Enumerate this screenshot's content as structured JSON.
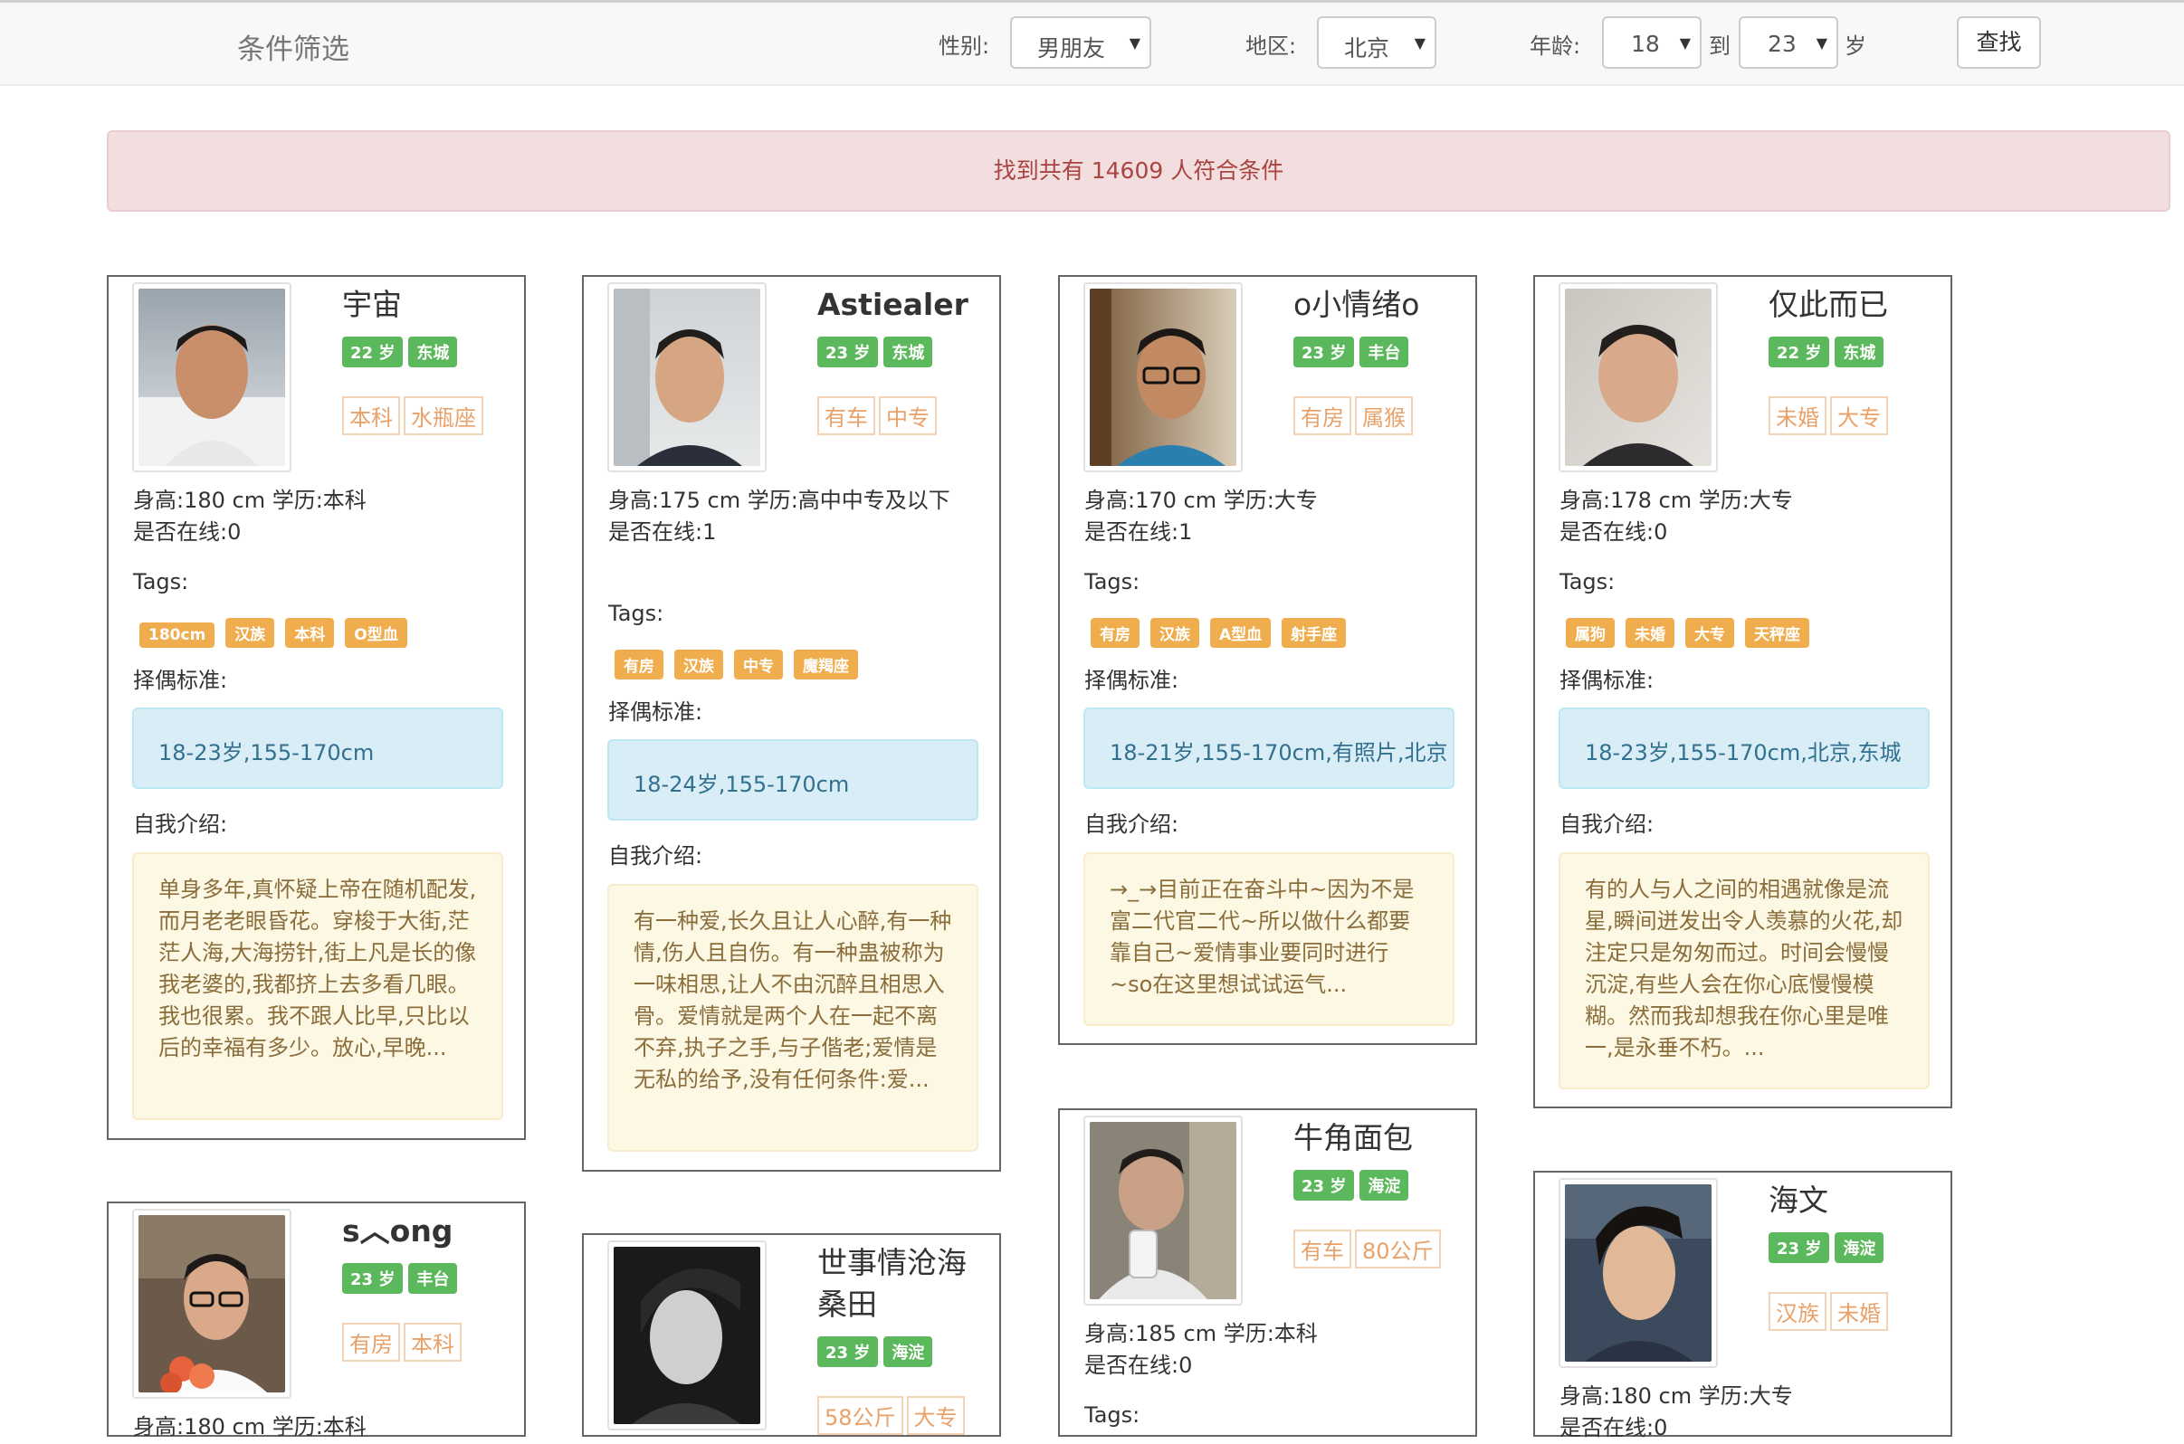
{
  "filter": {
    "title": "条件筛选",
    "gender_label": "性别:",
    "gender_value": "男朋友",
    "region_label": "地区:",
    "region_value": "北京",
    "age_label": "年龄:",
    "age_from": "18",
    "age_to_word": "到",
    "age_to": "23",
    "age_unit": "岁",
    "search_button": "查找"
  },
  "result": {
    "text": "找到共有 14609 人符合条件"
  },
  "labels": {
    "tags": "Tags:",
    "criteria": "择偶标准:",
    "intro": "自我介绍:"
  },
  "cards": [
    {
      "name": "宇宙",
      "age_badge": "22 岁",
      "district_badge": "东城",
      "traits": [
        "本科",
        "水瓶座"
      ],
      "height_line": "身高:180 cm   学历:本科",
      "online_line": "是否在线:0",
      "tags": [
        "180cm",
        "汉族",
        "本科",
        "O型血"
      ],
      "criteria": "18-23岁,155-170cm",
      "intro": "单身多年,真怀疑上帝在随机配发,而月老老眼昏花。穿梭于大街,茫茫人海,大海捞针,街上凡是长的像我老婆的,我都挤上去多看几眼。我也很累。我不跟人比早,只比以后的幸福有多少。放心,早晚..."
    },
    {
      "name": "Astiealer",
      "age_badge": "23 岁",
      "district_badge": "东城",
      "traits": [
        "有车",
        "中专"
      ],
      "height_line": "身高:175 cm   学历:高中中专及以下",
      "online_line": "是否在线:1",
      "tags": [
        "有房",
        "汉族",
        "中专",
        "魔羯座"
      ],
      "criteria": "18-24岁,155-170cm",
      "intro": "有一种爱,长久且让人心醉,有一种情,伤人且自伤。有一种蛊被称为一味相思,让人不由沉醉且相思入骨。爱情就是两个人在一起不离不弃,执子之手,与子偕老;爱情是无私的给予,没有任何条件:爱..."
    },
    {
      "name": "o小情绪o",
      "age_badge": "23 岁",
      "district_badge": "丰台",
      "traits": [
        "有房",
        "属猴"
      ],
      "height_line": "身高:170 cm   学历:大专",
      "online_line": "是否在线:1",
      "tags": [
        "有房",
        "汉族",
        "A型血",
        "射手座"
      ],
      "criteria": "18-21岁,155-170cm,有照片,北京",
      "intro": "→_→目前正在奋斗中~因为不是富二代官二代~所以做什么都要靠自己~爱情事业要同时进行~so在这里想试试运气..."
    },
    {
      "name": "仅此而已",
      "age_badge": "22 岁",
      "district_badge": "东城",
      "traits": [
        "未婚",
        "大专"
      ],
      "height_line": "身高:178 cm   学历:大专",
      "online_line": "是否在线:0",
      "tags": [
        "属狗",
        "未婚",
        "大专",
        "天秤座"
      ],
      "criteria": "18-23岁,155-170cm,北京,东城",
      "intro": "有的人与人之间的相遇就像是流星,瞬间迸发出令人羡慕的火花,却注定只是匆匆而过。时间会慢慢沉淀,有些人会在你心底慢慢模糊。然而我却想我在你心里是唯一,是永垂不朽。..."
    },
    {
      "name": "s︿ong",
      "age_badge": "23 岁",
      "district_badge": "丰台",
      "traits": [
        "有房",
        "本科"
      ],
      "height_line": "身高:180 cm   学历:本科"
    },
    {
      "name": "世事情沧海桑田",
      "age_badge": "23 岁",
      "district_badge": "海淀",
      "traits": [
        "58公斤",
        "大专"
      ]
    },
    {
      "name": "牛角面包",
      "age_badge": "23 岁",
      "district_badge": "海淀",
      "traits": [
        "有车",
        "80公斤"
      ],
      "height_line": "身高:185 cm   学历:本科",
      "online_line": "是否在线:0"
    },
    {
      "name": "海文",
      "age_badge": "23 岁",
      "district_badge": "海淀",
      "traits": [
        "汉族",
        "未婚"
      ],
      "height_line": "身高:180 cm   学历:大专",
      "online_line": "是否在线:0"
    }
  ]
}
